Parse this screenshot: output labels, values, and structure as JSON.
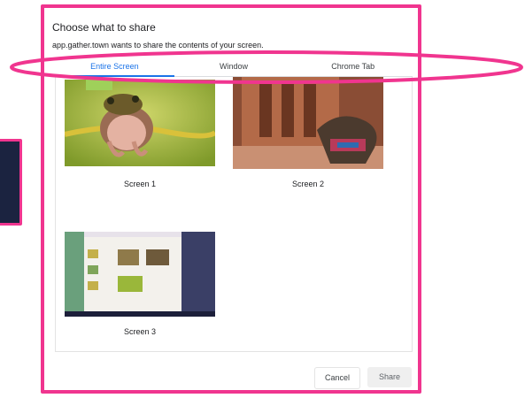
{
  "dialog": {
    "title": "Choose what to share",
    "subtitle": "app.gather.town wants to share the contents of your screen.",
    "tabs": [
      {
        "label": "Entire Screen",
        "active": true
      },
      {
        "label": "Window",
        "active": false
      },
      {
        "label": "Chrome Tab",
        "active": false
      }
    ],
    "screens": [
      {
        "label": "Screen 1",
        "image": "frog-on-branch"
      },
      {
        "label": "Screen 2",
        "image": "petra-treasury-with-camel"
      },
      {
        "label": "Screen 3",
        "image": "gather-town-app-screenshot"
      }
    ],
    "buttons": {
      "cancel": "Cancel",
      "share": "Share"
    }
  },
  "colors": {
    "highlight": "#f0358f",
    "accent": "#1a73e8"
  }
}
